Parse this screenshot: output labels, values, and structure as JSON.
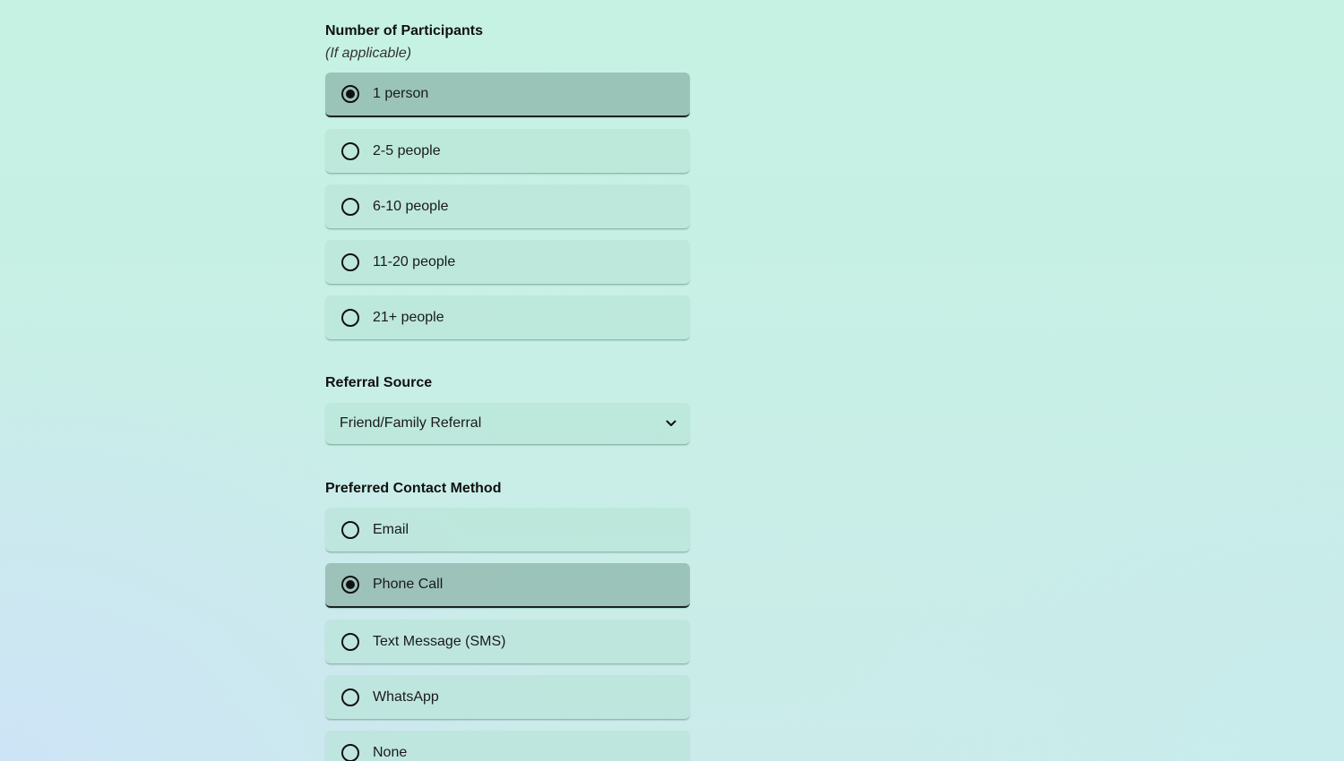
{
  "participants": {
    "label": "Number of Participants",
    "hint": "(If applicable)",
    "options": [
      {
        "label": "1 person",
        "selected": true
      },
      {
        "label": "2-5 people",
        "selected": false
      },
      {
        "label": "6-10 people",
        "selected": false
      },
      {
        "label": "11-20 people",
        "selected": false
      },
      {
        "label": "21+ people",
        "selected": false
      }
    ]
  },
  "referral": {
    "label": "Referral Source",
    "selected_value": "Friend/Family Referral",
    "icon": "chevron-down-icon"
  },
  "contact": {
    "label": "Preferred Contact Method",
    "options": [
      {
        "label": "Email",
        "selected": false
      },
      {
        "label": "Phone Call",
        "selected": true
      },
      {
        "label": "Text Message (SMS)",
        "selected": false
      },
      {
        "label": "WhatsApp",
        "selected": false
      },
      {
        "label": "None",
        "selected": false
      }
    ]
  },
  "colors": {
    "selected_bg": "#9fc4b9",
    "unselected_bg": "#bfe8dc",
    "text": "#111111",
    "bg_top_right": "#c6f2e3",
    "bg_bottom_left": "#cde4f6"
  }
}
